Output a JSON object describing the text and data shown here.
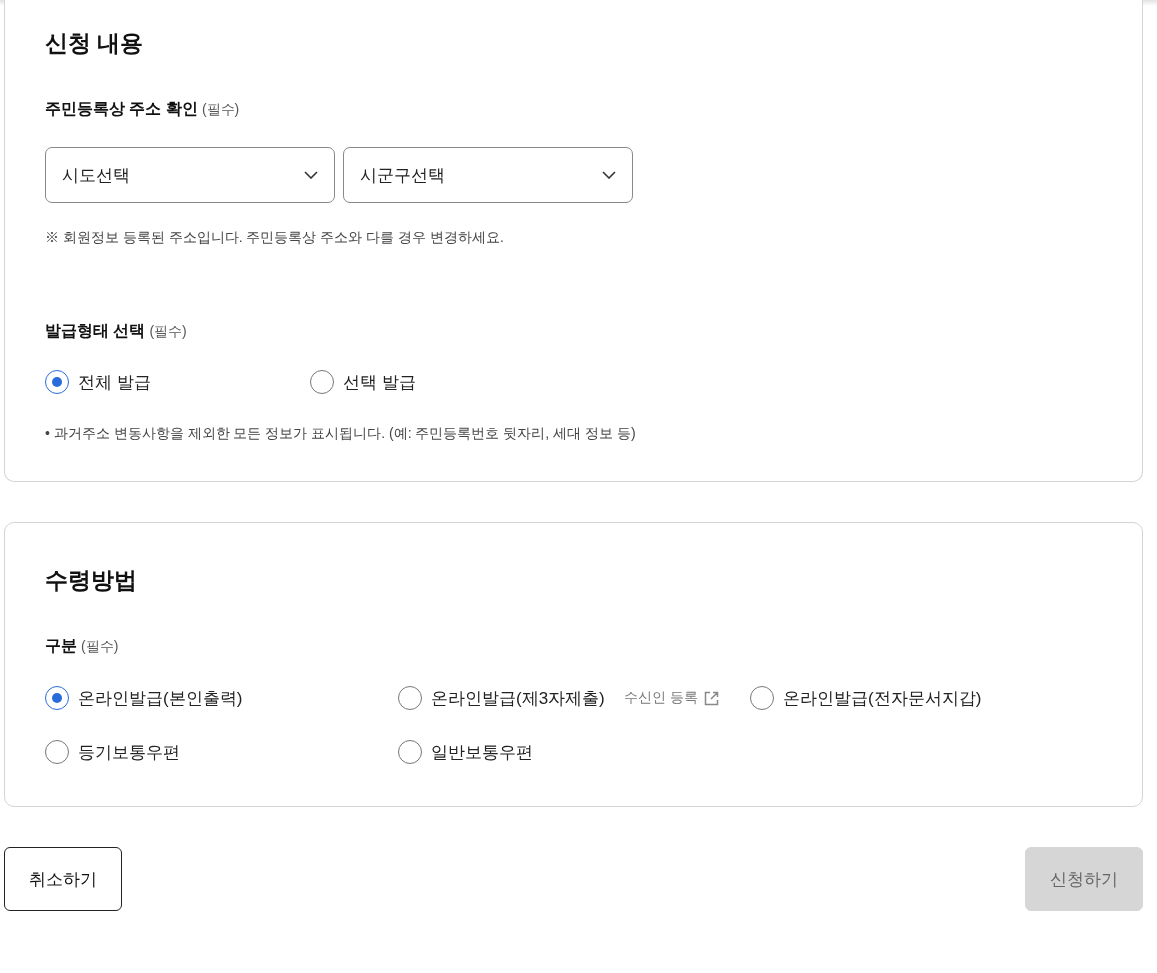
{
  "application": {
    "title": "신청 내용",
    "address": {
      "label": "주민등록상 주소 확인",
      "required": "(필수)",
      "selects": [
        {
          "placeholder": "시도선택"
        },
        {
          "placeholder": "시군구선택"
        }
      ],
      "note": "※ 회원정보 등록된 주소입니다. 주민등록상 주소와 다를 경우 변경하세요."
    },
    "issue_type": {
      "label": "발급형태 선택",
      "required": "(필수)",
      "options": [
        {
          "label": "전체 발급",
          "selected": true
        },
        {
          "label": "선택 발급",
          "selected": false
        }
      ],
      "note": "• 과거주소 변동사항을 제외한 모든 정보가 표시됩니다. (예: 주민등록번호 뒷자리, 세대 정보 등)"
    }
  },
  "receipt": {
    "title": "수령방법",
    "label": "구분",
    "required": "(필수)",
    "options": [
      {
        "label": "온라인발급(본인출력)",
        "selected": true
      },
      {
        "label": "온라인발급(제3자제출)",
        "selected": false,
        "link": "수신인 등록"
      },
      {
        "label": "온라인발급(전자문서지갑)",
        "selected": false
      },
      {
        "label": "등기보통우편",
        "selected": false
      },
      {
        "label": "일반보통우편",
        "selected": false
      }
    ]
  },
  "buttons": {
    "cancel": "취소하기",
    "submit": {
      "label": "신청하기",
      "disabled": true
    }
  }
}
